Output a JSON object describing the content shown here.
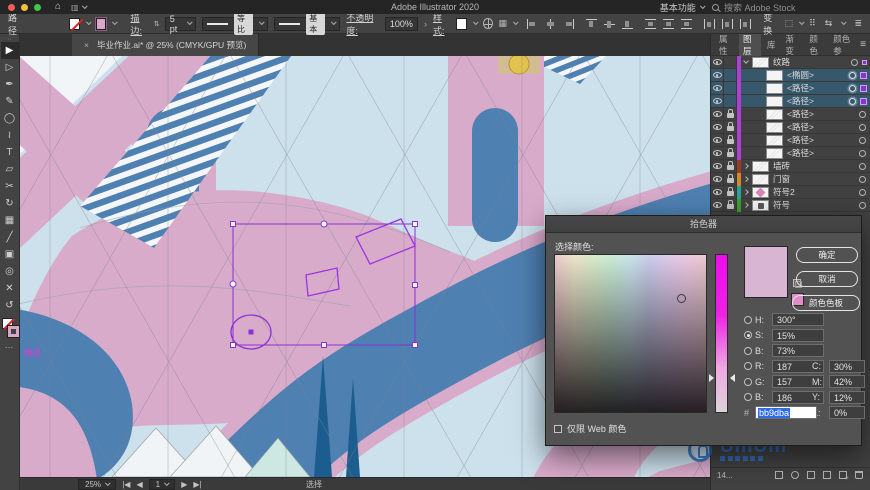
{
  "colors": {
    "sky": "#cde1ed",
    "pink": "#d9abca",
    "blue": "#4e80b2",
    "dark_blue": "#1c5d90",
    "white_shape": "#f2f5f7",
    "mint": "#cde8e2",
    "lamp_tan": "#d2bd93",
    "lamp_yellow": "#e3c250",
    "selection_purple": "#8b2fd6",
    "tag_magenta": "#ea35d4",
    "picker_preview": "#d9b5d4",
    "picker_chip": "#de8fc8"
  },
  "menubar": {
    "title": "Adobe Illustrator 2020",
    "workspace": "基本功能",
    "search_placeholder": "搜索 Adobe Stock"
  },
  "controlbar": {
    "context_label": "路径",
    "stroke_label": "描边:",
    "stroke_value": "5 pt",
    "profile_label": "等比",
    "brush_label": "基本",
    "opacity_label": "不透明度:",
    "opacity_value": "100%",
    "style_label": "样式:",
    "transform_label": "变换"
  },
  "tools": [
    {
      "name": "selection-tool",
      "glyph": "▶",
      "active": true
    },
    {
      "name": "direct-selection-tool",
      "glyph": "▷",
      "active": false
    },
    {
      "name": "pen-tool",
      "glyph": "✒",
      "active": false
    },
    {
      "name": "curvature-tool",
      "glyph": "✎",
      "active": false
    },
    {
      "name": "shaper-tool",
      "glyph": "◯",
      "active": false
    },
    {
      "name": "paintbrush-tool",
      "glyph": "≀",
      "active": false
    },
    {
      "name": "type-tool",
      "glyph": "T",
      "active": false
    },
    {
      "name": "free-transform-tool",
      "glyph": "▱",
      "active": false
    },
    {
      "name": "scissors-tool",
      "glyph": "✂",
      "active": false
    },
    {
      "name": "rotate-tool",
      "glyph": "↻",
      "active": false
    },
    {
      "name": "gradient-tool",
      "glyph": "▦",
      "active": false
    },
    {
      "name": "eyedropper-tool",
      "glyph": "╱",
      "active": false
    },
    {
      "name": "artboard-tool",
      "glyph": "▣",
      "active": false
    },
    {
      "name": "zoom-tool",
      "glyph": "◎",
      "active": false
    },
    {
      "name": "anchor-point-tool",
      "glyph": "✕",
      "active": false
    },
    {
      "name": "rotate-view-tool",
      "glyph": "↺",
      "active": false
    }
  ],
  "align_icons": [
    {
      "name": "align-left-icon",
      "cls": "a-l"
    },
    {
      "name": "align-h-center-icon",
      "cls": "a-ch"
    },
    {
      "name": "align-right-icon",
      "cls": "a-r"
    },
    {
      "name": "align-top-icon",
      "cls": "a-t g2"
    },
    {
      "name": "align-v-middle-icon",
      "cls": "a-vm"
    },
    {
      "name": "align-bottom-icon",
      "cls": "a-b"
    },
    {
      "name": "distribute-top-icon",
      "cls": "d-t g2"
    },
    {
      "name": "distribute-v-center-icon",
      "cls": "d-t"
    },
    {
      "name": "distribute-bottom-icon",
      "cls": "d-t"
    },
    {
      "name": "distribute-left-icon",
      "cls": "d-h g2"
    },
    {
      "name": "distribute-h-center-icon",
      "cls": "d-h"
    },
    {
      "name": "distribute-right-icon",
      "cls": "d-h"
    }
  ],
  "doc_tab": {
    "close": "×",
    "label": "毕业作业.ai* @ 25% (CMYK/GPU 预览)"
  },
  "canvas": {
    "selection_tag": "路径"
  },
  "statusbar": {
    "zoom": "25%",
    "nav_first": "|◀",
    "nav_prev": "◀",
    "artboard": "1",
    "nav_next": "▶",
    "nav_last": "▶|",
    "tool": "选择"
  },
  "layers_panel": {
    "tabs": [
      {
        "label": "属性",
        "active": false
      },
      {
        "label": "图层",
        "active": true
      },
      {
        "label": "库",
        "active": false
      },
      {
        "label": "渐变",
        "active": false
      },
      {
        "label": "颜色",
        "active": false
      },
      {
        "label": "颜色参",
        "active": false
      }
    ],
    "menu_icon": "≡",
    "rows": [
      {
        "name": "纹路",
        "color": "#b03fd6",
        "locked": false,
        "selected": false,
        "expand": "open",
        "indent": false,
        "target": "ring",
        "chip": "small",
        "thumb": "scribble"
      },
      {
        "name": "<椭圆>",
        "color": "#b03fd6",
        "locked": false,
        "selected": true,
        "expand": "",
        "indent": true,
        "target": "strong",
        "chip": "big",
        "thumb": "blank"
      },
      {
        "name": "<路径>",
        "color": "#b03fd6",
        "locked": false,
        "selected": true,
        "expand": "",
        "indent": true,
        "target": "strong",
        "chip": "big",
        "thumb": "blank"
      },
      {
        "name": "<路径>",
        "color": "#b03fd6",
        "locked": false,
        "selected": true,
        "expand": "",
        "indent": true,
        "target": "strong",
        "chip": "big",
        "thumb": "blank"
      },
      {
        "name": "<路径>",
        "color": "#b03fd6",
        "locked": true,
        "selected": false,
        "expand": "",
        "indent": true,
        "target": "ring",
        "chip": "none",
        "thumb": "scribble"
      },
      {
        "name": "<路径>",
        "color": "#b03fd6",
        "locked": true,
        "selected": false,
        "expand": "",
        "indent": true,
        "target": "ring",
        "chip": "none",
        "thumb": "scribble"
      },
      {
        "name": "<路径>",
        "color": "#b03fd6",
        "locked": true,
        "selected": false,
        "expand": "",
        "indent": true,
        "target": "ring",
        "chip": "none",
        "thumb": "scribble"
      },
      {
        "name": "<路径>",
        "color": "#b03fd6",
        "locked": true,
        "selected": false,
        "expand": "",
        "indent": true,
        "target": "ring",
        "chip": "none",
        "thumb": "scribble"
      },
      {
        "name": "墙砖",
        "color": "#9a3b2a",
        "locked": true,
        "selected": false,
        "expand": "closed",
        "indent": false,
        "target": "ring",
        "chip": "none",
        "thumb": "scribble"
      },
      {
        "name": "门窗",
        "color": "#d28a2a",
        "locked": true,
        "selected": false,
        "expand": "closed",
        "indent": false,
        "target": "ring",
        "chip": "none",
        "thumb": "scribble"
      },
      {
        "name": "符号2",
        "color": "#2aa39a",
        "locked": true,
        "selected": false,
        "expand": "closed",
        "indent": false,
        "target": "ring",
        "chip": "none",
        "thumb": "symbol-pink"
      },
      {
        "name": "符号",
        "color": "#3f9e2e",
        "locked": true,
        "selected": false,
        "expand": "closed",
        "indent": false,
        "target": "ring",
        "chip": "none",
        "thumb": "symbol-dark"
      }
    ],
    "footer_count": "14...",
    "footer_icons": [
      {
        "name": "collect-for-export-icon",
        "cls": ""
      },
      {
        "name": "locate-object-icon",
        "cls": "circ"
      },
      {
        "name": "make-mask-icon",
        "cls": ""
      },
      {
        "name": "new-sublayer-icon",
        "cls": ""
      },
      {
        "name": "new-layer-icon",
        "cls": "plus"
      },
      {
        "name": "delete-layer-icon",
        "cls": "trash"
      }
    ]
  },
  "color_picker": {
    "title": "拾色器",
    "select_label": "选择颜色:",
    "fields": [
      {
        "key": "H:",
        "value": "300°",
        "selected": false
      },
      {
        "key": "S:",
        "value": "15%",
        "selected": true
      },
      {
        "key": "B:",
        "value": "73%",
        "selected": false
      },
      {
        "key": "R:",
        "value": "187",
        "selected": false
      },
      {
        "key": "G:",
        "value": "157",
        "selected": false
      },
      {
        "key": "B:",
        "value": "186",
        "selected": false
      }
    ],
    "cmyk": [
      {
        "key": "C:",
        "value": "30%"
      },
      {
        "key": "M:",
        "value": "42%"
      },
      {
        "key": "Y:",
        "value": "12%"
      },
      {
        "key": "K:",
        "value": "0%"
      }
    ],
    "hex_prefix": "#",
    "hex": "bb9dba",
    "ok": "确定",
    "cancel": "取消",
    "swatches_btn": "颜色色板",
    "web_only": "仅限 Web 颜色"
  },
  "watermark": {
    "text": "UIIIUIII"
  }
}
